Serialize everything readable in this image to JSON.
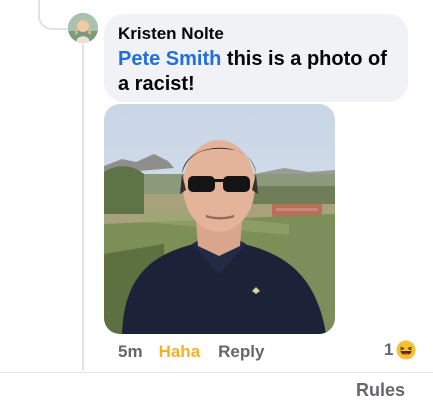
{
  "comment": {
    "author": "Kristen Nolte",
    "mention": "Pete Smith",
    "text": " this is a photo of a racist!"
  },
  "actions": {
    "time": "5m",
    "reaction_label": "Haha",
    "reply_label": "Reply",
    "reaction_count": "1"
  },
  "footer": {
    "rules_label": "Rules"
  },
  "icons": {
    "avatar": "user-avatar",
    "reaction": "haha-emoji-icon"
  },
  "colors": {
    "mention": "#216fdb",
    "haha": "#f7b125",
    "bubble": "#f0f2f5",
    "secondary_text": "#65676b"
  }
}
